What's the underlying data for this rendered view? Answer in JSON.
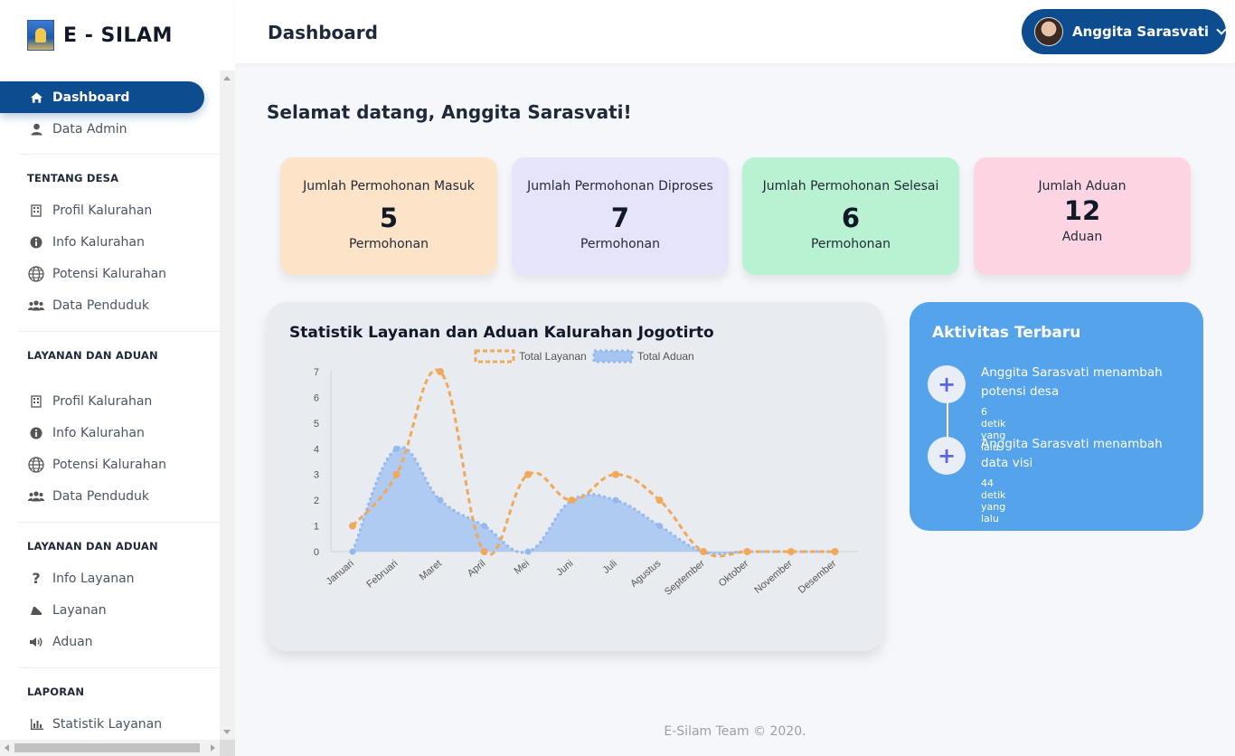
{
  "brand": {
    "title": "E - SILAM"
  },
  "sidebar": {
    "items_top": [
      {
        "label": "Dashboard",
        "icon": "home-icon",
        "active": true
      },
      {
        "label": "Data Admin",
        "icon": "user-icon"
      }
    ],
    "sections": [
      {
        "title": "TENTANG DESA",
        "items": [
          {
            "label": "Profil Kalurahan",
            "icon": "building-icon"
          },
          {
            "label": "Info Kalurahan",
            "icon": "info-icon"
          },
          {
            "label": "Potensi Kalurahan",
            "icon": "globe-icon"
          },
          {
            "label": "Data Penduduk",
            "icon": "users-icon"
          }
        ]
      },
      {
        "title": "LAYANAN DAN ADUAN",
        "items": [
          {
            "label": "Profil Kalurahan",
            "icon": "building-icon"
          },
          {
            "label": "Info Kalurahan",
            "icon": "info-icon"
          },
          {
            "label": "Potensi Kalurahan",
            "icon": "globe-icon"
          },
          {
            "label": "Data Penduduk",
            "icon": "users-icon"
          }
        ]
      },
      {
        "title": "LAYANAN DAN ADUAN",
        "items": [
          {
            "label": "Info Layanan",
            "icon": "question-icon"
          },
          {
            "label": "Layanan",
            "icon": "hand-icon"
          },
          {
            "label": "Aduan",
            "icon": "volume-icon"
          }
        ]
      },
      {
        "title": "LAPORAN",
        "items": [
          {
            "label": "Statistik Layanan",
            "icon": "bar-chart-icon"
          }
        ]
      }
    ]
  },
  "topbar": {
    "title": "Dashboard",
    "user_name": "Anggita Sarasvati"
  },
  "welcome": "Selamat datang, Anggita Sarasvati!",
  "cards": [
    {
      "label": "Jumlah Permohonan Masuk",
      "value": "5",
      "unit": "Permohonan",
      "color": "#fde4c8"
    },
    {
      "label": "Jumlah Permohonan Diproses",
      "value": "7",
      "unit": "Permohonan",
      "color": "#e6e4fb"
    },
    {
      "label": "Jumlah Permohonan Selesai",
      "value": "6",
      "unit": "Permohonan",
      "color": "#b9f2d3"
    },
    {
      "label": "Jumlah Aduan",
      "value": "12",
      "unit": "Aduan",
      "color": "#fdd5e2"
    }
  ],
  "chart_data": {
    "type": "line",
    "title": "Statistik Layanan dan Aduan Kalurahan Jogotirto",
    "categories": [
      "Januari",
      "Februari",
      "Maret",
      "April",
      "Mei",
      "Juni",
      "Juli",
      "Agustus",
      "September",
      "Oktober",
      "November",
      "Desember"
    ],
    "series": [
      {
        "name": "Total Layanan",
        "values": [
          1,
          3,
          7,
          0,
          3,
          2,
          3,
          2,
          0,
          0,
          0,
          0
        ],
        "color": "#f0a95a",
        "style": "dashed-line"
      },
      {
        "name": "Total Aduan",
        "values": [
          0,
          4,
          2,
          1,
          0,
          2,
          2,
          1,
          0,
          0,
          0,
          0
        ],
        "color": "#a4c5f2",
        "style": "filled-area"
      }
    ],
    "yticks": [
      "0",
      "1",
      "2",
      "3",
      "4",
      "5",
      "6",
      "7"
    ],
    "ylim": [
      0,
      7
    ],
    "legend": "top"
  },
  "activity": {
    "title": "Aktivitas Terbaru",
    "items": [
      {
        "text": "Anggita Sarasvati menambah potensi desa",
        "time": "6 detik yang lalu"
      },
      {
        "text": "Anggita Sarasvati menambah data visi",
        "time": "44 detik yang lalu"
      }
    ]
  },
  "footer": "E-Silam Team © 2020."
}
